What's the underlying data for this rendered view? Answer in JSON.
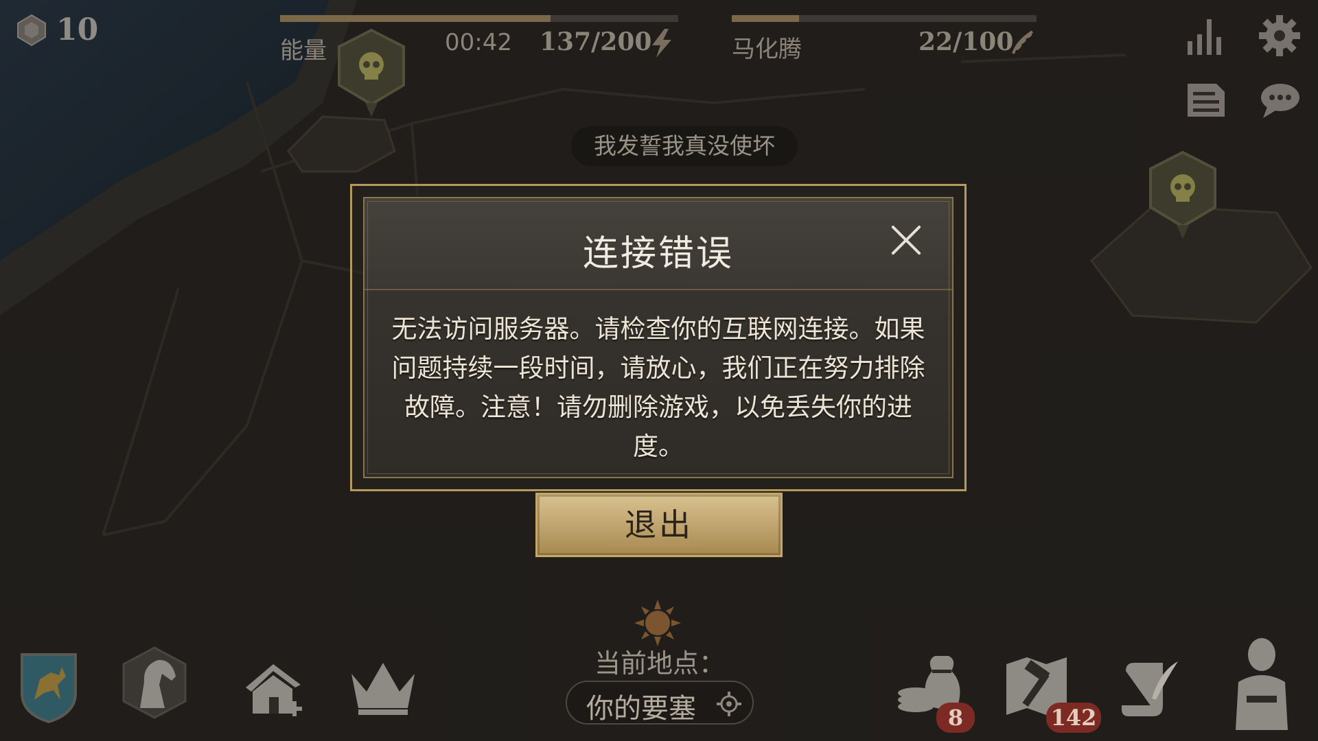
{
  "top_bar": {
    "resource_count": "10",
    "energy": {
      "label": "能量",
      "timer": "00:42",
      "value": "137/200",
      "progress": 0.68
    },
    "player": {
      "name": "马化腾",
      "value": "22/100",
      "progress": 0.22
    }
  },
  "hint_text": "我发誓我真没使坏",
  "dialog": {
    "title": "连接错误",
    "message": "无法访问服务器。请检查你的互联网连接。如果问题持续一段时间，请放心，我们正在努力排除故障。注意！请勿删除游戏，以免丢失你的进度。",
    "exit_label": "退出"
  },
  "location": {
    "label": "当前地点：",
    "value": "你的要塞"
  },
  "bottom_bar": {
    "resources_badge": "8",
    "build_badge": "142"
  },
  "colors": {
    "gold": "#b69a5e",
    "button": "#c9ad74",
    "badge_red": "#7e2a24",
    "bar_fill": "#7a6848"
  },
  "icons": [
    "shield-gem-icon",
    "lightning-icon",
    "laurel-icon",
    "stats-icon",
    "gear-icon",
    "document-icon",
    "chat-icon",
    "skull-icon",
    "sun-icon",
    "horse-head-icon",
    "house-add-icon",
    "crown-icon",
    "money-bag-icon",
    "map-hammer-icon",
    "scroll-quill-icon",
    "hero-icon",
    "coat-of-arms-icon",
    "locate-icon"
  ]
}
